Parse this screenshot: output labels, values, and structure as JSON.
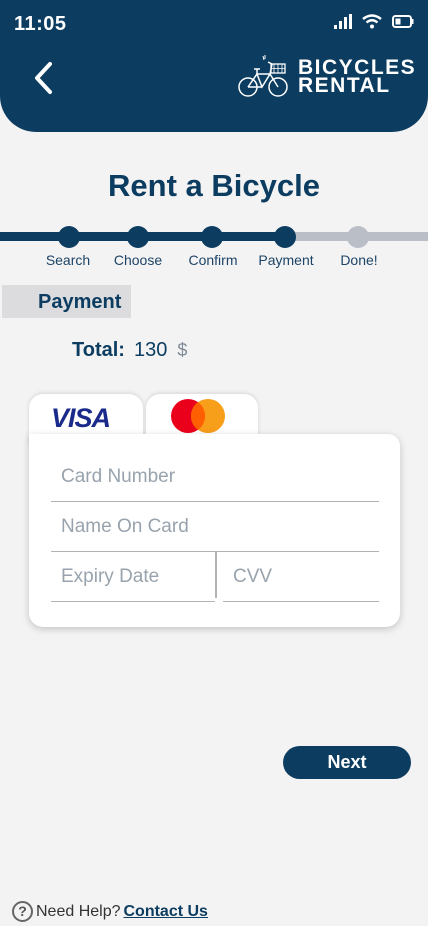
{
  "status_bar": {
    "time": "11:05",
    "icons": [
      "signal-icon",
      "wifi-icon",
      "battery-icon"
    ]
  },
  "header": {
    "back_icon": "chevron-left-icon",
    "logo_icon": "bicycle-icon",
    "logo_line1": "BICYCLES",
    "logo_line2": "RENTAL"
  },
  "page_title": "Rent a Bicycle",
  "progress": {
    "current_step": 4,
    "steps": [
      {
        "label": "Search",
        "done": true
      },
      {
        "label": "Choose",
        "done": true
      },
      {
        "label": "Confirm",
        "done": true
      },
      {
        "label": "Payment",
        "done": true
      },
      {
        "label": "Done!",
        "done": false
      }
    ]
  },
  "section_label": "Payment",
  "total": {
    "label": "Total:",
    "value": "130",
    "currency": "$"
  },
  "payment_tabs": [
    {
      "name": "VISA",
      "icon": "visa-logo",
      "selected": true
    },
    {
      "name": "Mastercard",
      "icon": "mastercard-logo",
      "selected": false
    }
  ],
  "card_form": {
    "card_number": {
      "value": "",
      "placeholder": "Card Number"
    },
    "name_on_card": {
      "value": "",
      "placeholder": "Name On Card"
    },
    "expiry_date": {
      "value": "",
      "placeholder": "Expiry Date"
    },
    "cvv": {
      "value": "",
      "placeholder": "CVV"
    }
  },
  "next_button": "Next",
  "footer": {
    "help_icon": "question-circle-icon",
    "help_text": "Need Help?",
    "contact_link": "Contact Us"
  },
  "colors": {
    "primary": "#0c3d61",
    "inactive": "#b9bec7",
    "background": "#f3f3f3",
    "visa_blue": "#1a2a8a",
    "mc_red": "#eb001b",
    "mc_orange": "#f79e1b"
  }
}
